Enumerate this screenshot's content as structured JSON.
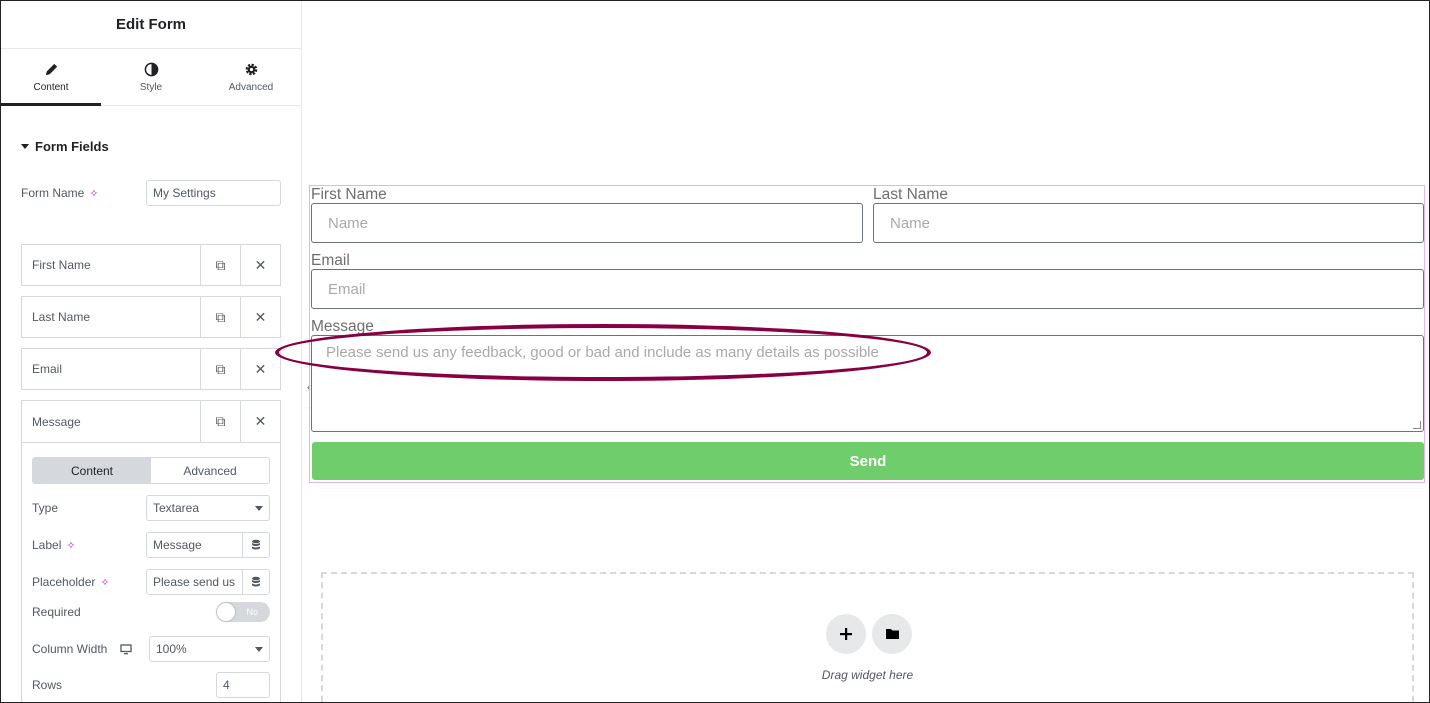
{
  "sidebar": {
    "title": "Edit Form",
    "tabs": [
      {
        "label": "Content",
        "icon": "pencil-icon",
        "active": true
      },
      {
        "label": "Style",
        "icon": "contrast-icon",
        "active": false
      },
      {
        "label": "Advanced",
        "icon": "gear-icon",
        "active": false
      }
    ],
    "section_title": "Form Fields",
    "form_name_label": "Form Name",
    "form_name_value": "My Settings",
    "fields": [
      "First Name",
      "Last Name",
      "Email"
    ],
    "expanded_field": {
      "title": "Message",
      "subtabs": [
        "Content",
        "Advanced"
      ],
      "type_label": "Type",
      "type_value": "Textarea",
      "label_label": "Label",
      "label_value": "Message",
      "placeholder_label": "Placeholder",
      "placeholder_value": "Please send us",
      "required_label": "Required",
      "required_value": "No",
      "column_width_label": "Column Width",
      "column_width_value": "100%",
      "rows_label": "Rows",
      "rows_value": "4"
    }
  },
  "form": {
    "first_name_label": "First Name",
    "first_name_placeholder": "Name",
    "last_name_label": "Last Name",
    "last_name_placeholder": "Name",
    "email_label": "Email",
    "email_placeholder": "Email",
    "message_label": "Message",
    "message_placeholder": "Please send us any feedback, good or bad and include as many details as possible",
    "send_label": "Send"
  },
  "dropzone": {
    "text": "Drag widget here"
  },
  "colors": {
    "accent_green": "#6fce6b",
    "highlight": "#880041",
    "widget_outline": "#e7b3ef"
  }
}
